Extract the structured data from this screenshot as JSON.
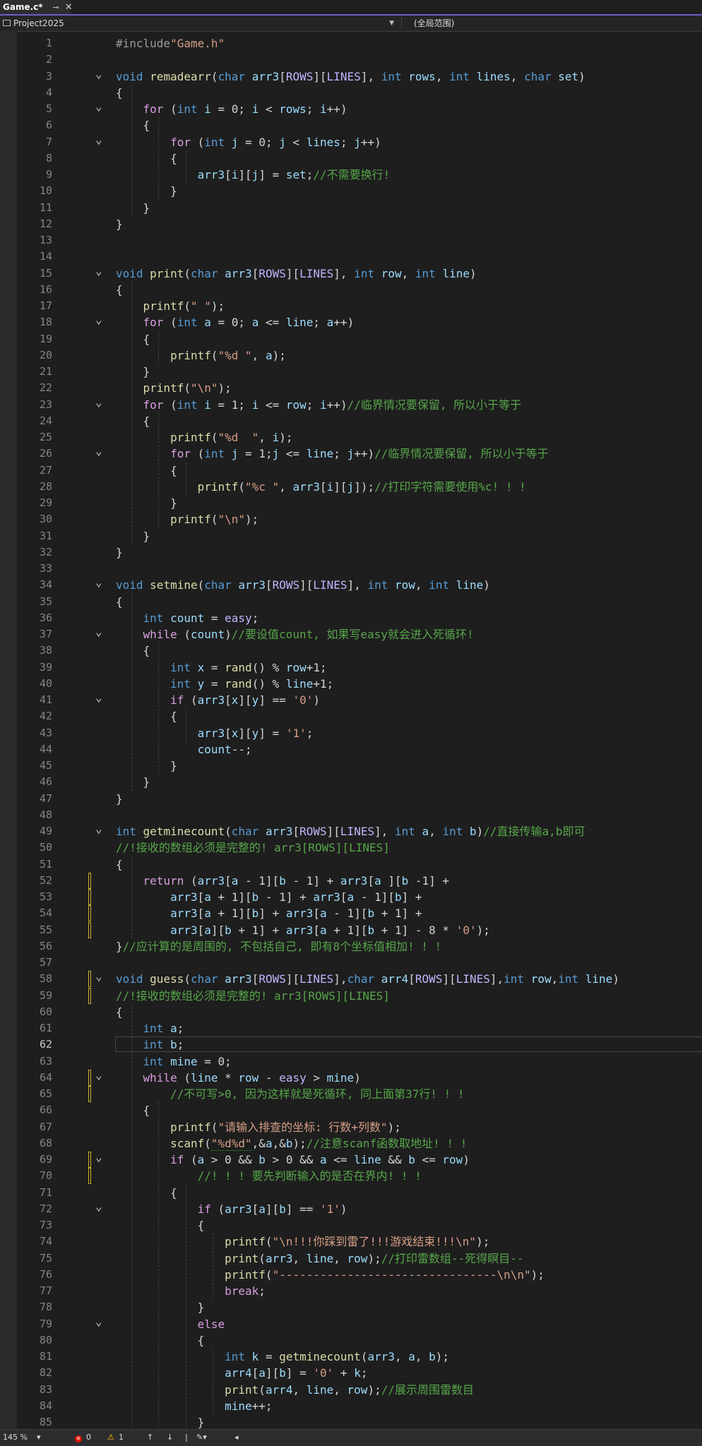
{
  "tab": {
    "title": "Game.c*",
    "pin": "⊸",
    "close": "✕"
  },
  "nav": {
    "project": "Project2025",
    "scope": "(全局范围)"
  },
  "status": {
    "zoom": "145 %",
    "errors": "0",
    "warnings": "1"
  },
  "current_line": 62,
  "lines": [
    "#include\"Game.h\"",
    "",
    "void remadearr(char arr3[ROWS][LINES], int rows, int lines, char set)",
    "{",
    "    for (int i = 0; i < rows; i++)",
    "    {",
    "        for (int j = 0; j < lines; j++)",
    "        {",
    "            arr3[i][j] = set;//不需要换行!",
    "        }",
    "    }",
    "}",
    "",
    "",
    "void print(char arr3[ROWS][LINES], int row, int line)",
    "{",
    "    printf(\" \");",
    "    for (int a = 0; a <= line; a++)",
    "    {",
    "        printf(\"%d \", a);",
    "    }",
    "    printf(\"\\n\");",
    "    for (int i = 1; i <= row; i++)//临界情况要保留, 所以小于等于",
    "    {",
    "        printf(\"%d  \", i);",
    "        for (int j = 1;j <= line; j++)//临界情况要保留, 所以小于等于",
    "        {",
    "            printf(\"%c \", arr3[i][j]);//打印字符需要使用%c! ! !",
    "        }",
    "        printf(\"\\n\");",
    "    }",
    "}",
    "",
    "void setmine(char arr3[ROWS][LINES], int row, int line)",
    "{",
    "    int count = easy;",
    "    while (count)//要设值count, 如果写easy就会进入死循环!",
    "    {",
    "        int x = rand() % row+1;",
    "        int y = rand() % line+1;",
    "        if (arr3[x][y] == '0')",
    "        {",
    "            arr3[x][y] = '1';",
    "            count--;",
    "        }",
    "    }",
    "}",
    "",
    "int getminecount(char arr3[ROWS][LINES], int a, int b)//直接传输a,b即可",
    "//!接收的数组必须是完整的! arr3[ROWS][LINES]",
    "{",
    "    return (arr3[a - 1][b - 1] + arr3[a ][b -1] +",
    "        arr3[a + 1][b - 1] + arr3[a - 1][b] +",
    "        arr3[a + 1][b] + arr3[a - 1][b + 1] +",
    "        arr3[a][b + 1] + arr3[a + 1][b + 1] - 8 * '0');",
    "}//应计算的是周围的, 不包括自己, 即有8个坐标值相加! ! !",
    "",
    "void guess(char arr3[ROWS][LINES],char arr4[ROWS][LINES],int row,int line)",
    "//!接收的数组必须是完整的! arr3[ROWS][LINES]",
    "{",
    "    int a;",
    "    int b;",
    "    int mine = 0;",
    "    while (line * row - easy > mine)",
    "        //不可写>0, 因为这样就是死循环, 同上面第37行! ! !",
    "    {",
    "        printf(\"请输入排查的坐标: 行数+列数\");",
    "        scanf(\"%d%d\",&a,&b);//注意scanf函数取地址! ! !",
    "        if (a > 0 && b > 0 && a <= line && b <= row)",
    "            //! ! ! 要先判断输入的是否在界内! ! !",
    "        {",
    "            if (arr3[a][b] == '1')",
    "            {",
    "                printf(\"\\n!!!你踩到雷了!!!游戏结束!!!\\n\");",
    "                print(arr3, line, row);//打印雷数组--死得瞑目--",
    "                printf(\"--------------------------------\\n\\n\");",
    "                break;",
    "            }",
    "            else",
    "            {",
    "                int k = getminecount(arr3, a, b);",
    "                arr4[a][b] = '0' + k;",
    "                print(arr4, line, row);//展示周围雷数目",
    "                mine++;",
    "            }",
    "        }"
  ]
}
